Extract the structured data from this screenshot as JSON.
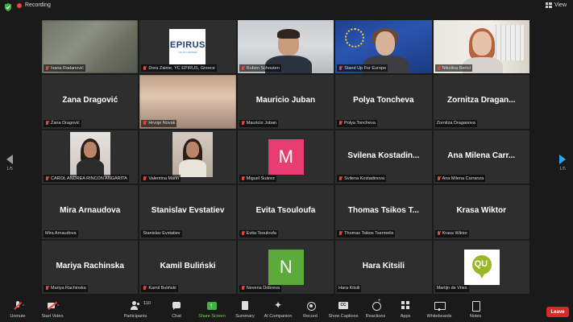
{
  "topbar": {
    "recording_label": "Recording",
    "view_label": "View",
    "shield_color": "#3fb23f",
    "record_color": "#e8453c"
  },
  "pager": {
    "left_page": "1/5",
    "right_page": "1/5"
  },
  "tiles": [
    {
      "label": "Ivana Radanović",
      "kind": "video",
      "muted": true
    },
    {
      "label": "Dora Zaime, YC EPIRUS, Greece",
      "kind": "logo",
      "logo_text": "EPIRUS",
      "logo_subtext": "YOUTH CENTER",
      "muted": true
    },
    {
      "label": "Ruben Schouten",
      "kind": "video",
      "muted": true
    },
    {
      "label": "Stand Up For Europe",
      "kind": "video",
      "muted": true,
      "active": true
    },
    {
      "label": "Nikolina Bertol",
      "kind": "video",
      "muted": true
    },
    {
      "name": "Žana Dragović",
      "label": "Žana Dragović",
      "muted": true
    },
    {
      "label": "Hrvoje Novak",
      "kind": "video",
      "muted": true
    },
    {
      "name": "Mauricio Juban",
      "label": "Mauricio Juban",
      "muted": true
    },
    {
      "name": "Polya Toncheva",
      "label": "Polya Toncheva",
      "muted": true
    },
    {
      "name": "Zornitza Dragan...",
      "label": "Zornitza Draganova",
      "muted": false
    },
    {
      "label": "CAROL ANDREA RINCON ANGARITA",
      "kind": "video",
      "muted": true
    },
    {
      "label": "Valentina Marin",
      "kind": "video",
      "muted": true
    },
    {
      "label": "Miguel Suárez",
      "kind": "letter",
      "letter": "M",
      "color": "#e63d72",
      "muted": true
    },
    {
      "name": "Svilena Kostadin...",
      "label": "Svilena Kostadinova",
      "muted": true
    },
    {
      "name": "Ana Milena Carr...",
      "label": "Ana Milena Carranza",
      "muted": true
    },
    {
      "name": "Mira Arnaudova",
      "label": "Mira Arnaudova",
      "muted": false
    },
    {
      "name": "Stanislav Evstatiev",
      "label": "Stanislav Evstatiev",
      "muted": false
    },
    {
      "name": "Evita Tsouloufa",
      "label": "Evita Tsouloufa",
      "muted": true
    },
    {
      "name": "Thomas Tsikos T...",
      "label": "Thomas Tsikos Tsermelis",
      "muted": true
    },
    {
      "name": "Krasa Wiktor",
      "label": "Krasa Wiktor",
      "muted": true
    },
    {
      "name": "Mariya Rachinska",
      "label": "Mariya Rachinska",
      "muted": true
    },
    {
      "name": "Kamil Buliński",
      "label": "Kamil Buliński",
      "muted": true
    },
    {
      "label": "Nevena Dobreva",
      "kind": "letter",
      "letter": "N",
      "color": "#5cab3a",
      "muted": true
    },
    {
      "name": "Hara Kitsili",
      "label": "Hara Kitsili",
      "muted": false
    },
    {
      "label": "Martijn de Vries",
      "kind": "logo-qu",
      "logo_text": "QU",
      "muted": false
    }
  ],
  "toolbar": {
    "unmute": "Unmute",
    "start_video": "Start Video",
    "participants": "Participants",
    "participants_count": "110",
    "chat": "Chat",
    "share_screen": "Share Screen",
    "summary": "Summary",
    "ai_companion": "AI Companion",
    "record": "Record",
    "show_captions": "Show Captions",
    "reactions": "Reactions",
    "apps": "Apps",
    "whiteboards": "Whiteboards",
    "notes": "Notes",
    "leave": "Leave",
    "caret": "^"
  },
  "colors": {
    "active_speaker": "#7ed44b",
    "share_green": "#3fb23f",
    "leave_red": "#d82a2a",
    "next_arrow": "#2ea3f2"
  }
}
